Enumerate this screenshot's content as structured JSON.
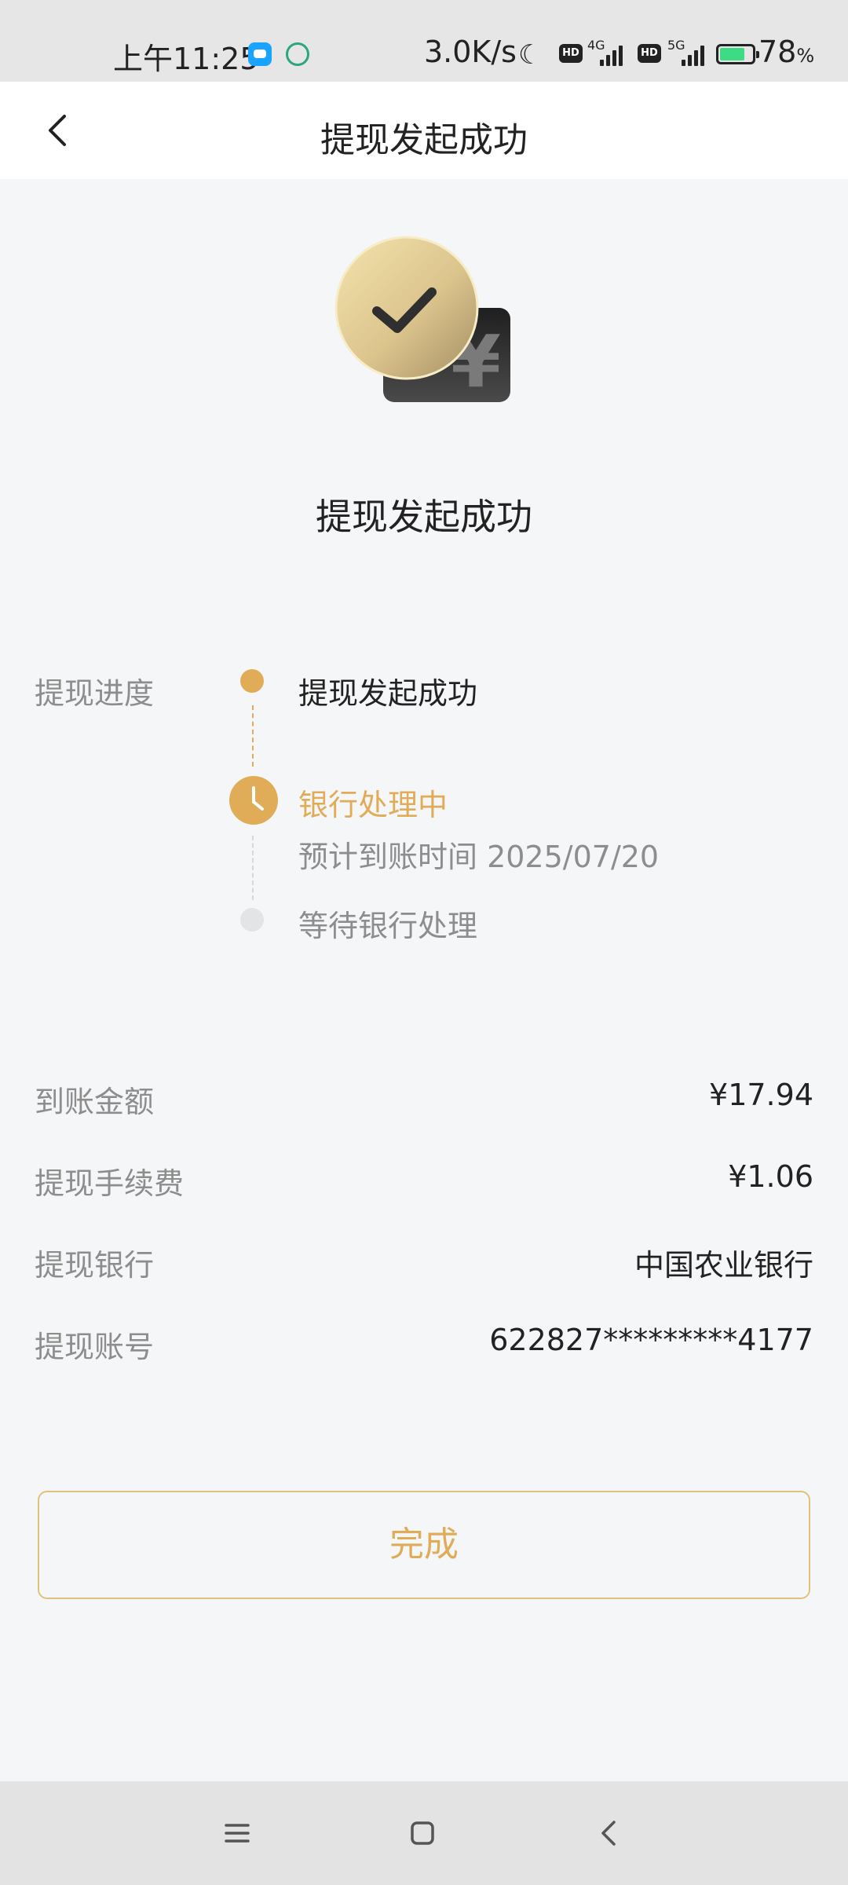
{
  "status_bar": {
    "time": "上午11:25",
    "speed": "3.0K/s",
    "net1": "4G",
    "net2": "5G",
    "hd": "HD",
    "battery": "78",
    "battery_unit": "%",
    "battery_level": 0.78
  },
  "header": {
    "title": "提现发起成功"
  },
  "hero": {
    "title": "提现发起成功",
    "currency_symbol": "¥"
  },
  "progress": {
    "label": "提现进度",
    "steps": [
      {
        "title": "提现发起成功",
        "status": "done"
      },
      {
        "title": "银行处理中",
        "subtitle": "预计到账时间 2025/07/20",
        "status": "current"
      },
      {
        "title": "等待银行处理",
        "status": "pending"
      }
    ]
  },
  "details": [
    {
      "label": "到账金额",
      "value": "¥17.94"
    },
    {
      "label": "提现手续费",
      "value": "¥1.06"
    },
    {
      "label": "提现银行",
      "value": "中国农业银行"
    },
    {
      "label": "提现账号",
      "value": "622827*********4177"
    }
  ],
  "done_button": {
    "label": "完成"
  },
  "colors": {
    "accent": "#e0ac58",
    "background": "#f5f6f8",
    "text": "#222222",
    "muted": "#8d8d8d"
  }
}
